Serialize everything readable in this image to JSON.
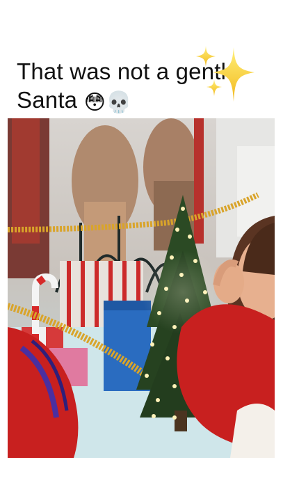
{
  "caption": {
    "line1": "That was not a gentle",
    "line2": "Santa",
    "emojis": [
      "😳",
      "💀"
    ]
  },
  "decorations": {
    "sparkles": "sparkles-emoji"
  },
  "video_frame": {
    "scene": "christmas-mall-santa-set",
    "colors": {
      "red_sweater": "#c8201f",
      "tinsel": "#d9a42a",
      "tree": "#2b4a24",
      "lights": "#fff2b8",
      "floor": "#cfe6ea",
      "gift_blue": "#2a6cc0"
    }
  }
}
